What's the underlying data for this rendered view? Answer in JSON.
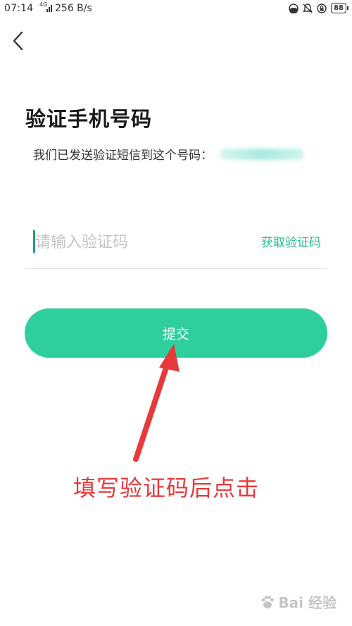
{
  "status_bar": {
    "time": "07:14",
    "network": "4G",
    "speed": "256 B/s",
    "battery": "88",
    "icons": [
      "signal-icon",
      "theme-icon",
      "mute-bell-icon",
      "lock-rotate-icon",
      "battery-icon"
    ]
  },
  "header": {
    "back_icon": "chevron-left-icon"
  },
  "page": {
    "title": "验证手机号码",
    "subtitle": "我们已发送验证短信到这个号码："
  },
  "form": {
    "code_placeholder": "请输入验证码",
    "code_value": "",
    "get_code_label": "获取验证码",
    "submit_label": "提交"
  },
  "annotation": {
    "text": "填写验证码后点击",
    "color": "#e83a3a"
  },
  "colors": {
    "accent": "#2ecf9d",
    "accent_text": "#2bbf93"
  },
  "watermark": {
    "text": "Bai 经验"
  }
}
